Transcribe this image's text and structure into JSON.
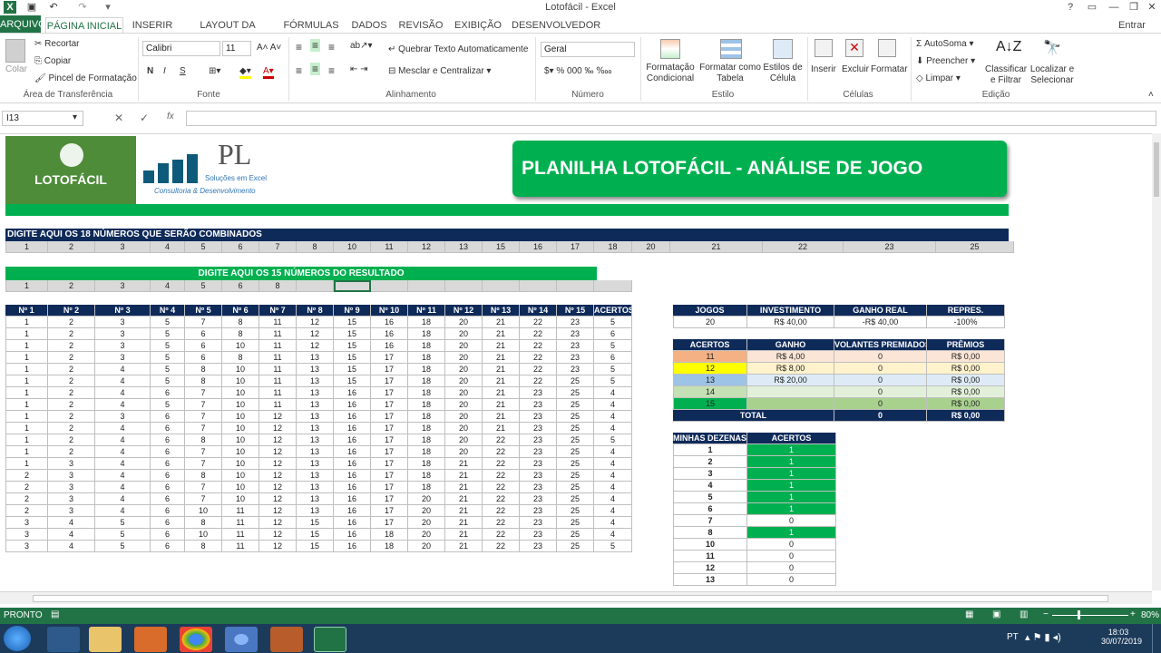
{
  "window": {
    "title": "Lotofácil - Excel",
    "signin": "Entrar"
  },
  "tabs": [
    "ARQUIVO",
    "PÁGINA INICIAL",
    "INSERIR",
    "LAYOUT DA PÁGINA",
    "FÓRMULAS",
    "DADOS",
    "REVISÃO",
    "EXIBIÇÃO",
    "DESENVOLVEDOR"
  ],
  "ribbon": {
    "clipboard": {
      "paste": "Colar",
      "cut": "Recortar",
      "copy": "Copiar",
      "format_painter": "Pincel de Formatação",
      "label": "Área de Transferência"
    },
    "font": {
      "name": "Calibri",
      "size": "11",
      "bold": "N",
      "italic": "I",
      "underline": "S",
      "label": "Fonte"
    },
    "alignment": {
      "wrap": "Quebrar Texto Automaticamente",
      "merge": "Mesclar e Centralizar",
      "label": "Alinhamento"
    },
    "number": {
      "format": "Geral",
      "label": "Número"
    },
    "styles": {
      "conditional": "Formatação Condicional",
      "table": "Formatar como Tabela",
      "cell": "Estilos de Célula",
      "label": "Estilo"
    },
    "cells": {
      "insert": "Inserir",
      "delete": "Excluir",
      "format": "Formatar",
      "label": "Células"
    },
    "editing": {
      "autosum": "AutoSoma",
      "fill": "Preencher",
      "clear": "Limpar",
      "sort": "Classificar e Filtrar",
      "find": "Localizar e Selecionar",
      "label": "Edição"
    }
  },
  "formula_bar": {
    "name_box": "I13",
    "fx": "fx",
    "value": ""
  },
  "banner": {
    "logo_text": "LOTOFÁCIL",
    "pl_main": "PL",
    "pl_sub": "Soluções em Excel",
    "pl_sub2": "Consultoria & Desenvolvimento",
    "title": "PLANILHA LOTOFÁCIL - ANÁLISE DE JOGO"
  },
  "combined": {
    "header": "DIGITE AQUI OS 18 NÚMEROS QUE SERÃO COMBINADOS",
    "numbers": [
      "1",
      "2",
      "3",
      "4",
      "5",
      "6",
      "7",
      "8",
      "10",
      "11",
      "12",
      "13",
      "15",
      "16",
      "17",
      "18",
      "20",
      "21",
      "22",
      "23",
      "25"
    ]
  },
  "result": {
    "header": "DIGITE AQUI OS 15 NÚMEROS DO RESULTADO",
    "numbers": [
      "1",
      "2",
      "3",
      "4",
      "5",
      "6",
      "8",
      "",
      "",
      "",
      "",
      "",
      "",
      "",
      "",
      ""
    ]
  },
  "games": {
    "headers": [
      "Nº 1",
      "Nº 2",
      "Nº 3",
      "Nº 4",
      "Nº 5",
      "Nº 6",
      "Nº 7",
      "Nº 8",
      "Nº 9",
      "Nº 10",
      "Nº 11",
      "Nº 12",
      "Nº 13",
      "Nº 14",
      "Nº 15",
      "ACERTOS"
    ],
    "rows": [
      [
        "1",
        "2",
        "3",
        "5",
        "7",
        "8",
        "11",
        "12",
        "15",
        "16",
        "18",
        "20",
        "21",
        "22",
        "23",
        "5"
      ],
      [
        "1",
        "2",
        "3",
        "5",
        "6",
        "8",
        "11",
        "12",
        "15",
        "16",
        "18",
        "20",
        "21",
        "22",
        "23",
        "6"
      ],
      [
        "1",
        "2",
        "3",
        "5",
        "6",
        "10",
        "11",
        "12",
        "15",
        "16",
        "18",
        "20",
        "21",
        "22",
        "23",
        "5"
      ],
      [
        "1",
        "2",
        "3",
        "5",
        "6",
        "8",
        "11",
        "13",
        "15",
        "17",
        "18",
        "20",
        "21",
        "22",
        "23",
        "6"
      ],
      [
        "1",
        "2",
        "4",
        "5",
        "8",
        "10",
        "11",
        "13",
        "15",
        "17",
        "18",
        "20",
        "21",
        "22",
        "23",
        "5"
      ],
      [
        "1",
        "2",
        "4",
        "5",
        "8",
        "10",
        "11",
        "13",
        "15",
        "17",
        "18",
        "20",
        "21",
        "22",
        "25",
        "5"
      ],
      [
        "1",
        "2",
        "4",
        "6",
        "7",
        "10",
        "11",
        "13",
        "16",
        "17",
        "18",
        "20",
        "21",
        "23",
        "25",
        "4"
      ],
      [
        "1",
        "2",
        "4",
        "5",
        "7",
        "10",
        "11",
        "13",
        "16",
        "17",
        "18",
        "20",
        "21",
        "23",
        "25",
        "4"
      ],
      [
        "1",
        "2",
        "3",
        "6",
        "7",
        "10",
        "12",
        "13",
        "16",
        "17",
        "18",
        "20",
        "21",
        "23",
        "25",
        "4"
      ],
      [
        "1",
        "2",
        "4",
        "6",
        "7",
        "10",
        "12",
        "13",
        "16",
        "17",
        "18",
        "20",
        "21",
        "23",
        "25",
        "4"
      ],
      [
        "1",
        "2",
        "4",
        "6",
        "8",
        "10",
        "12",
        "13",
        "16",
        "17",
        "18",
        "20",
        "22",
        "23",
        "25",
        "5"
      ],
      [
        "1",
        "2",
        "4",
        "6",
        "7",
        "10",
        "12",
        "13",
        "16",
        "17",
        "18",
        "20",
        "22",
        "23",
        "25",
        "4"
      ],
      [
        "1",
        "3",
        "4",
        "6",
        "7",
        "10",
        "12",
        "13",
        "16",
        "17",
        "18",
        "21",
        "22",
        "23",
        "25",
        "4"
      ],
      [
        "2",
        "3",
        "4",
        "6",
        "8",
        "10",
        "12",
        "13",
        "16",
        "17",
        "18",
        "21",
        "22",
        "23",
        "25",
        "4"
      ],
      [
        "2",
        "3",
        "4",
        "6",
        "7",
        "10",
        "12",
        "13",
        "16",
        "17",
        "18",
        "21",
        "22",
        "23",
        "25",
        "4"
      ],
      [
        "2",
        "3",
        "4",
        "6",
        "7",
        "10",
        "12",
        "13",
        "16",
        "17",
        "20",
        "21",
        "22",
        "23",
        "25",
        "4"
      ],
      [
        "2",
        "3",
        "4",
        "6",
        "10",
        "11",
        "12",
        "13",
        "16",
        "17",
        "20",
        "21",
        "22",
        "23",
        "25",
        "4"
      ],
      [
        "3",
        "4",
        "5",
        "6",
        "8",
        "11",
        "12",
        "15",
        "16",
        "17",
        "20",
        "21",
        "22",
        "23",
        "25",
        "4"
      ],
      [
        "3",
        "4",
        "5",
        "6",
        "10",
        "11",
        "12",
        "15",
        "16",
        "18",
        "20",
        "21",
        "22",
        "23",
        "25",
        "4"
      ],
      [
        "3",
        "4",
        "5",
        "6",
        "8",
        "11",
        "12",
        "15",
        "16",
        "18",
        "20",
        "21",
        "22",
        "23",
        "25",
        "5"
      ]
    ]
  },
  "summary": {
    "headers": [
      "JOGOS",
      "INVESTIMENTO",
      "GANHO REAL",
      "REPRES."
    ],
    "values": [
      "20",
      "R$ 40,00",
      "-R$ 40,00",
      "-100%"
    ]
  },
  "prizes": {
    "headers": [
      "ACERTOS",
      "GANHO",
      "VOLANTES PREMIADOS",
      "PRÊMIOS"
    ],
    "rows": [
      {
        "hits": "11",
        "gain": "R$ 4,00",
        "count": "0",
        "prize": "R$ 0,00",
        "color": "#f4b183",
        "light": "#fbe5d6"
      },
      {
        "hits": "12",
        "gain": "R$ 8,00",
        "count": "0",
        "prize": "R$ 0,00",
        "color": "#ffff00",
        "light": "#fff2cc"
      },
      {
        "hits": "13",
        "gain": "R$ 20,00",
        "count": "0",
        "prize": "R$ 0,00",
        "color": "#9dc3e6",
        "light": "#deebf7"
      },
      {
        "hits": "14",
        "gain": "",
        "count": "0",
        "prize": "R$ 0,00",
        "color": "#c5e0b4",
        "light": "#e2f0d9"
      },
      {
        "hits": "15",
        "gain": "",
        "count": "0",
        "prize": "R$ 0,00",
        "color": "#00b050",
        "light": "#a9d18e"
      }
    ],
    "total_label": "TOTAL",
    "total_count": "0",
    "total_prize": "R$ 0,00"
  },
  "tens": {
    "headers": [
      "MINHAS DEZENAS",
      "ACERTOS"
    ],
    "rows": [
      [
        "1",
        "1"
      ],
      [
        "2",
        "1"
      ],
      [
        "3",
        "1"
      ],
      [
        "4",
        "1"
      ],
      [
        "5",
        "1"
      ],
      [
        "6",
        "1"
      ],
      [
        "7",
        "0"
      ],
      [
        "8",
        "1"
      ],
      [
        "10",
        "0"
      ],
      [
        "11",
        "0"
      ],
      [
        "12",
        "0"
      ],
      [
        "13",
        "0"
      ]
    ]
  },
  "status": {
    "ready": "PRONTO",
    "zoom": "80%"
  },
  "taskbar": {
    "lang": "PT",
    "time": "18:03",
    "date": "30/07/2019"
  },
  "colors": {
    "excel_green": "#217346",
    "navy": "#0e2a59",
    "banner_green": "#00b050",
    "logo_green": "#4e8c3a"
  }
}
